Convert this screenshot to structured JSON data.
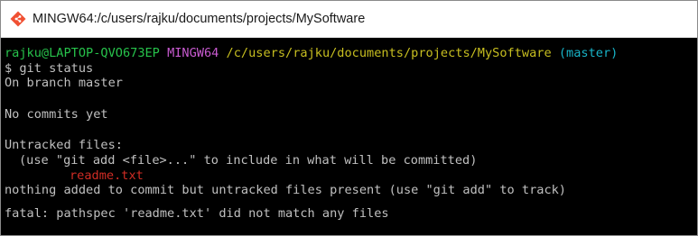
{
  "window": {
    "title": "MINGW64:/c/users/rajku/documents/projects/MySoftware",
    "icon": "git-bash-icon"
  },
  "terminal": {
    "prompt": {
      "user_host": "rajku@LAPTOP-QVO673EP",
      "env": "MINGW64",
      "path": "/c/users/rajku/documents/projects/MySoftware",
      "branch": "(master)"
    },
    "command": "$ git status",
    "output": {
      "on_branch": "On branch master",
      "no_commits": "No commits yet",
      "untracked_header": "Untracked files:",
      "untracked_hint": "(use \"git add <file>...\" to include in what will be committed)",
      "untracked_file": "readme.txt",
      "nothing_added": "nothing added to commit but untracked files present (use \"git add\" to track)",
      "fatal": "fatal: pathspec 'readme.txt' did not match any files"
    }
  },
  "colors": {
    "background": "#000000",
    "text": "#c0c0c0",
    "user_host": "#27c24b",
    "env": "#c85bd0",
    "path": "#c8bf20",
    "branch": "#18b4c8",
    "untracked_file": "#d02c24"
  }
}
